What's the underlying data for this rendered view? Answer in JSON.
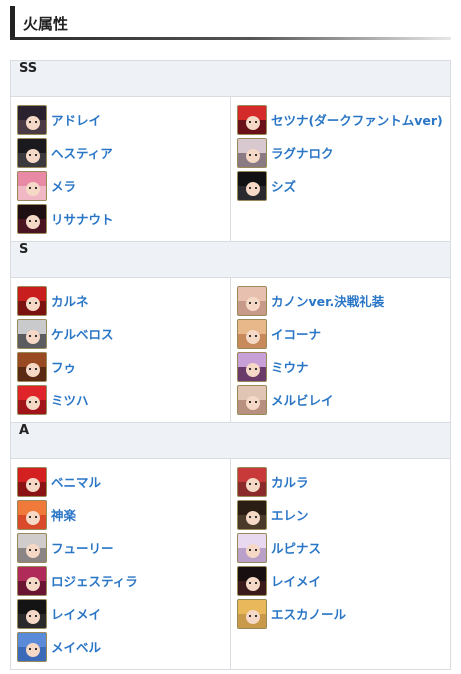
{
  "section_title": "火属性",
  "tiers": [
    {
      "label": "SS",
      "left": [
        {
          "name": "アドレイ",
          "icon": "character-portrait-icon",
          "bg": "#4a3a44",
          "hair": "#2b2230"
        },
        {
          "name": "ヘスティア",
          "icon": "character-portrait-icon",
          "bg": "#3a3a3e",
          "hair": "#1a1a1e"
        },
        {
          "name": "メラ",
          "icon": "character-portrait-icon",
          "bg": "#f0b8c4",
          "hair": "#e88aa6"
        },
        {
          "name": "リサナウト",
          "icon": "character-portrait-icon",
          "bg": "#4a1420",
          "hair": "#1e0f12"
        }
      ],
      "right": [
        {
          "name": "セツナ(ダークファントムver)",
          "icon": "character-portrait-icon",
          "bg": "#6a1018",
          "hair": "#d42a2a"
        },
        {
          "name": "ラグナロク",
          "icon": "character-portrait-icon",
          "bg": "#8a7a84",
          "hair": "#d8c8d0"
        },
        {
          "name": "シズ",
          "icon": "character-portrait-icon",
          "bg": "#2a2a2e",
          "hair": "#111114"
        }
      ]
    },
    {
      "label": "S",
      "left": [
        {
          "name": "カルネ",
          "icon": "character-portrait-icon",
          "bg": "#7a1212",
          "hair": "#c81e1e"
        },
        {
          "name": "ケルベロス",
          "icon": "character-portrait-icon",
          "bg": "#5a5c60",
          "hair": "#c8cacc"
        },
        {
          "name": "フゥ",
          "icon": "character-portrait-icon",
          "bg": "#5a2a14",
          "hair": "#9a4a22"
        },
        {
          "name": "ミツハ",
          "icon": "character-portrait-icon",
          "bg": "#a0141a",
          "hair": "#e0252a"
        }
      ],
      "right": [
        {
          "name": "カノンver.決戦礼装",
          "icon": "character-portrait-icon",
          "bg": "#c89a8a",
          "hair": "#e8c0b0"
        },
        {
          "name": "イコーナ",
          "icon": "character-portrait-icon",
          "bg": "#c88a5a",
          "hair": "#e8b88a"
        },
        {
          "name": "ミウナ",
          "icon": "character-portrait-icon",
          "bg": "#6a3a6a",
          "hair": "#c8a0d8"
        },
        {
          "name": "メルビレイ",
          "icon": "character-portrait-icon",
          "bg": "#b89080",
          "hair": "#e0c4b4"
        }
      ]
    },
    {
      "label": "A",
      "left": [
        {
          "name": "ベニマル",
          "icon": "character-portrait-icon",
          "bg": "#8a1414",
          "hair": "#d42020"
        },
        {
          "name": "神楽",
          "icon": "character-portrait-icon",
          "bg": "#d84a2a",
          "hair": "#f07a3a"
        },
        {
          "name": "フューリー",
          "icon": "character-portrait-icon",
          "bg": "#8a8484",
          "hair": "#d0cccc"
        },
        {
          "name": "ロジェスティラ",
          "icon": "character-portrait-icon",
          "bg": "#6a1434",
          "hair": "#b02a5a"
        },
        {
          "name": "レイメイ",
          "icon": "character-portrait-icon",
          "bg": "#2a2a2a",
          "hair": "#141414"
        },
        {
          "name": "メイベル",
          "icon": "character-portrait-icon",
          "bg": "#3a6ab8",
          "hair": "#5a8ad8"
        }
      ],
      "right": [
        {
          "name": "カルラ",
          "icon": "character-portrait-icon",
          "bg": "#8a2a2a",
          "hair": "#c83a3a"
        },
        {
          "name": "エレン",
          "icon": "character-portrait-icon",
          "bg": "#4a3a2a",
          "hair": "#2a1e14"
        },
        {
          "name": "ルピナス",
          "icon": "character-portrait-icon",
          "bg": "#b8a0c8",
          "hair": "#e8d8f0"
        },
        {
          "name": "レイメイ",
          "icon": "character-portrait-icon",
          "bg": "#3a1a1a",
          "hair": "#181010"
        },
        {
          "name": "エスカノール",
          "icon": "character-portrait-icon",
          "bg": "#c89a4a",
          "hair": "#e8b85a"
        }
      ]
    }
  ],
  "colors": {
    "link": "#2a76c6",
    "tier_header_bg": "#eef2f6",
    "border": "#d9dde2"
  }
}
